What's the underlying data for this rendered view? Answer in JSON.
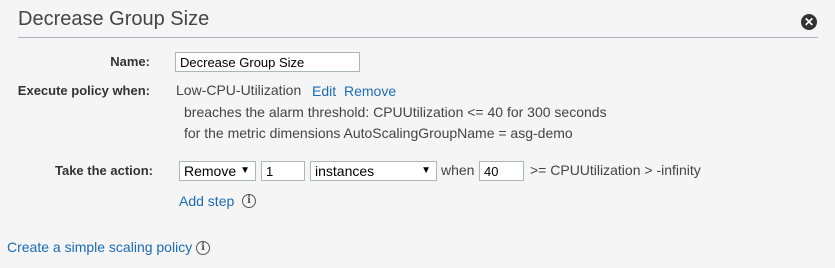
{
  "dialog": {
    "title": "Decrease Group Size",
    "close_icon": "✕"
  },
  "form": {
    "name_label": "Name:",
    "name_value": "Decrease Group Size",
    "execute_label": "Execute policy when:",
    "alarm_name": "Low-CPU-Utilization",
    "edit_link": "Edit",
    "remove_link": "Remove",
    "breach_text": "breaches the alarm threshold: CPUUtilization <= 40 for 300 seconds",
    "dimension_text": "for the metric dimensions AutoScalingGroupName = asg-demo",
    "action_label": "Take the action:",
    "action_select": "Remove",
    "quantity_value": "1",
    "unit_select": "instances",
    "when_text": "when",
    "when_value": "40",
    "range_text": ">= CPUUtilization > -infinity",
    "add_step_link": "Add step"
  },
  "footer": {
    "simple_policy_link": "Create a simple scaling policy"
  }
}
